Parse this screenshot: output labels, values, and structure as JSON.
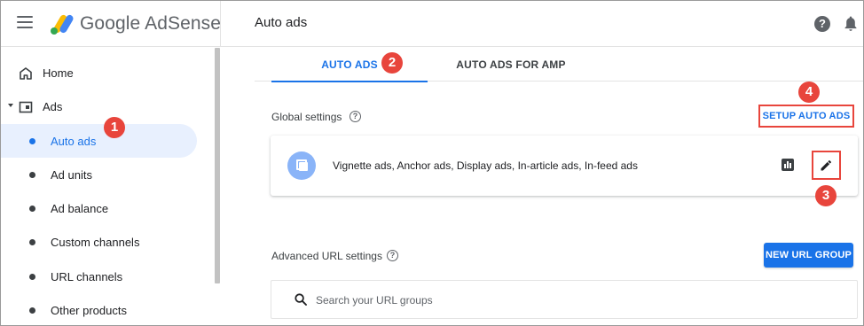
{
  "app": {
    "brand": "Google AdSense",
    "page_title": "Auto ads",
    "colors": {
      "accent": "#1a73e8",
      "callout": "#e8453c",
      "active_nav_bg": "#e8f0fe",
      "format_icon_bg": "#8ab4f8"
    }
  },
  "topbar": {
    "menu_icon": "menu-icon",
    "help_icon": "help-icon",
    "help_glyph": "?",
    "notifications_icon": "bell-icon"
  },
  "sidebar": {
    "items": [
      {
        "label": "Home",
        "icon": "home-icon"
      },
      {
        "label": "Ads",
        "icon": "ads-icon",
        "expanded": true
      },
      {
        "label": "Auto ads",
        "active": true
      },
      {
        "label": "Ad units"
      },
      {
        "label": "Ad balance"
      },
      {
        "label": "Custom channels"
      },
      {
        "label": "URL channels"
      },
      {
        "label": "Other products"
      }
    ]
  },
  "main": {
    "tabs": [
      {
        "label": "AUTO ADS",
        "selected": true
      },
      {
        "label": "AUTO ADS FOR AMP",
        "selected": false
      }
    ],
    "global_settings": {
      "label": "Global settings",
      "help_glyph": "?",
      "setup_button": "SETUP AUTO ADS",
      "card": {
        "formats_text": "Vignette ads, Anchor ads, Display ads, In-article ads, In-feed ads",
        "format_icon": "ad-formats-icon",
        "report_icon": "bar-chart-icon",
        "edit_icon": "pencil-icon"
      }
    },
    "advanced_url": {
      "label": "Advanced URL settings",
      "help_glyph": "?",
      "new_button": "NEW URL GROUP",
      "search_placeholder": "Search your URL groups"
    }
  },
  "callouts": [
    "1",
    "2",
    "3",
    "4"
  ]
}
